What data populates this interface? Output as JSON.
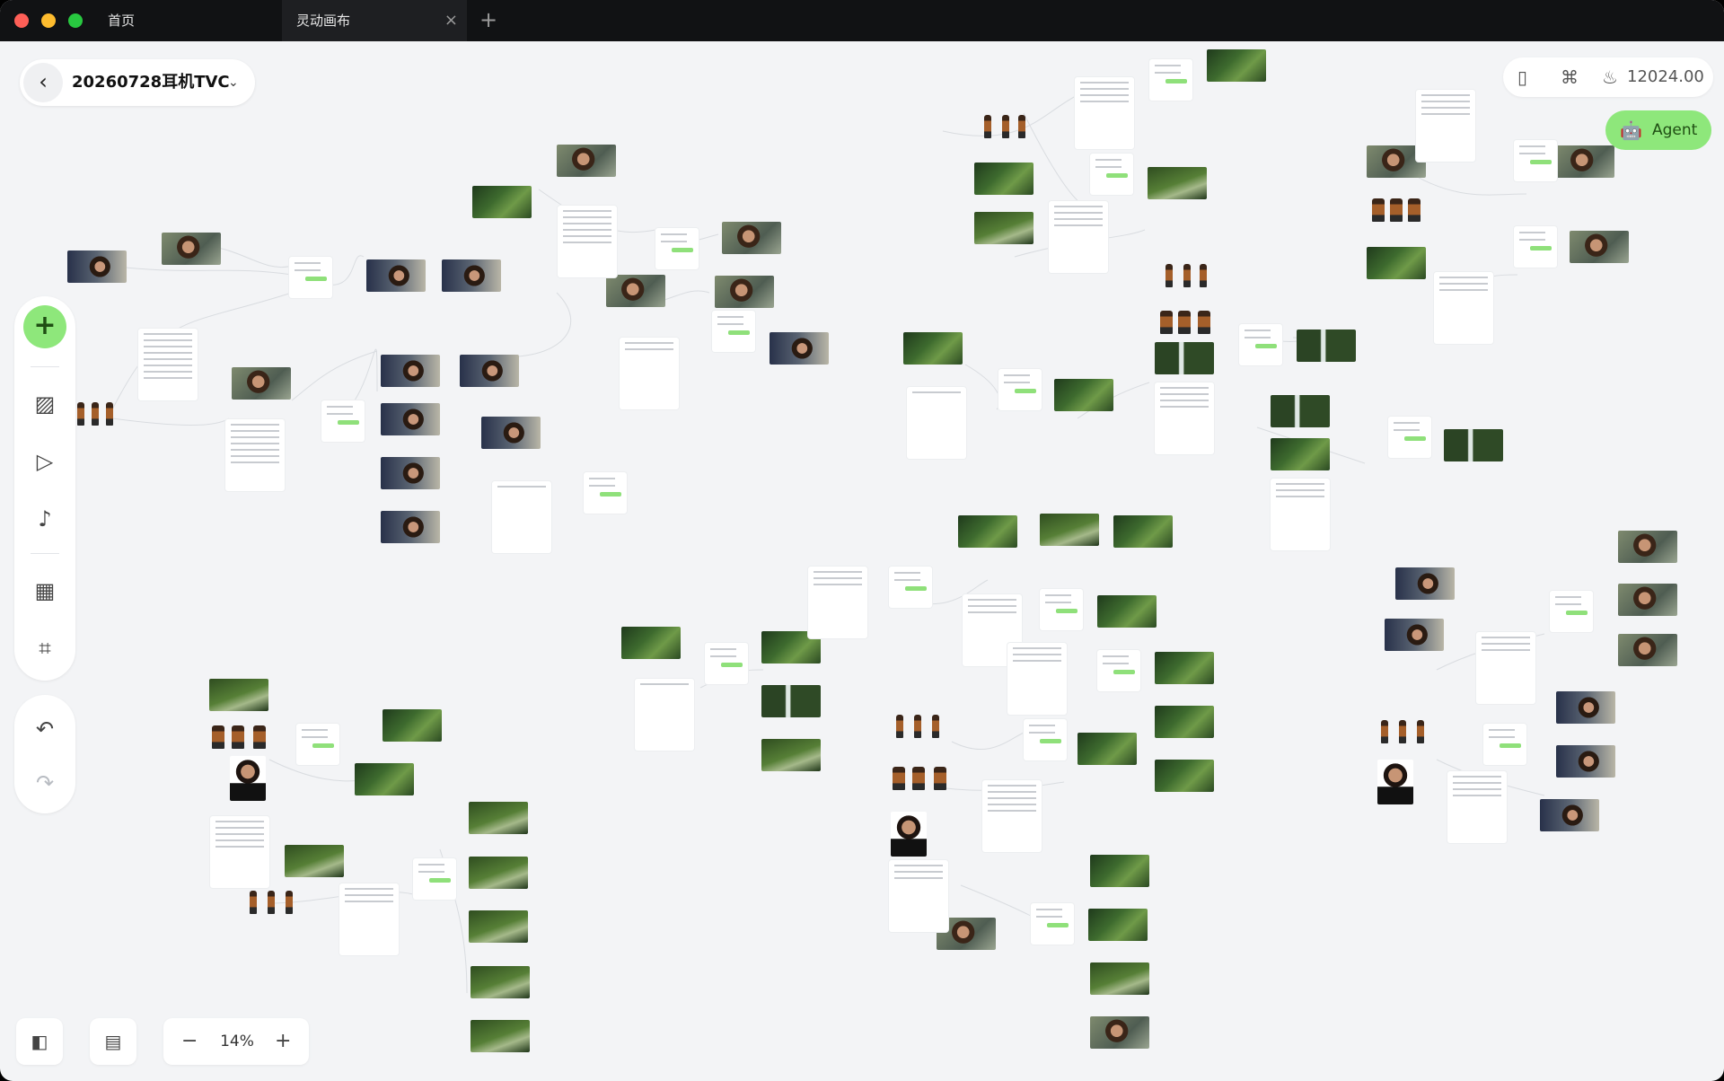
{
  "tabs": {
    "home": "首页",
    "active": "灵动画布",
    "close_icon": "×",
    "new_icon": "+"
  },
  "project": {
    "back_icon": "‹",
    "title": "20260728耳机TVC",
    "dropdown_icon": "⌄"
  },
  "toolbar_right": {
    "book_icon": "▯",
    "command_icon": "⌘",
    "flame_icon": "♨",
    "credits": "12024.00"
  },
  "agent": {
    "icon": "🤖",
    "label": "Agent"
  },
  "rail": {
    "add_icon": "+",
    "image_gen_icon": "▨",
    "video_gen_icon": "▷",
    "audio_gen_icon": "♪",
    "storyboard_icon": "▦",
    "frame_icon": "⌗"
  },
  "history": {
    "undo_icon": "↶",
    "redo_icon": "↷"
  },
  "bottom": {
    "layout_icon": "◧",
    "assets_icon": "▤",
    "zoom_out_icon": "−",
    "zoom_level": "14%",
    "zoom_in_icon": "+"
  },
  "colors": {
    "accent_green": "#8ee77b",
    "canvas_bg": "#f3f4f6",
    "titlebar_bg": "#111214"
  }
}
